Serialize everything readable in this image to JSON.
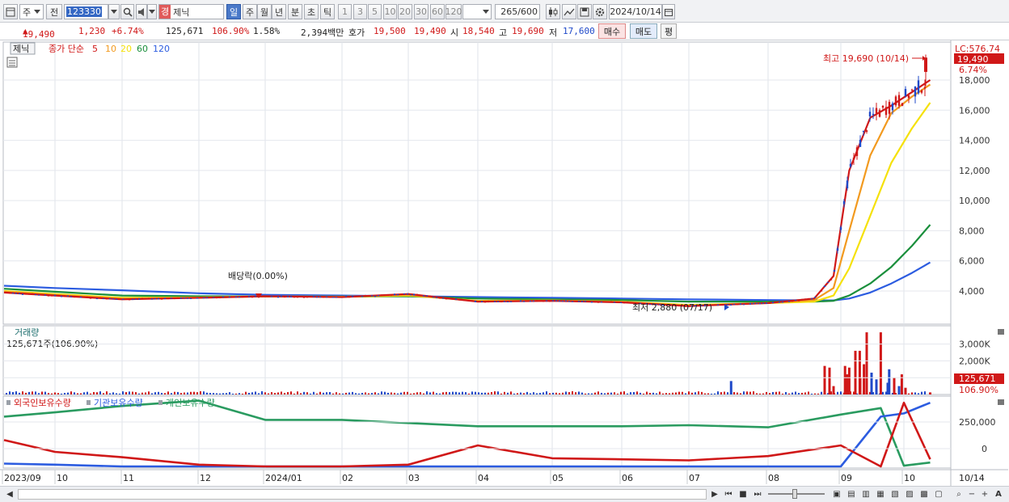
{
  "toolbar": {
    "market_label": "주",
    "prev_label": "전",
    "code_value": "123330",
    "grade_badge": "경",
    "stock_name": "제닉",
    "period_tabs": [
      "일",
      "주",
      "월",
      "년",
      "분",
      "초",
      "틱"
    ],
    "interval_buttons": [
      "1",
      "3",
      "5",
      "10",
      "20",
      "30",
      "60",
      "120"
    ],
    "count_value": "265",
    "count_total": "/600",
    "date_value": "2024/10/14"
  },
  "info": {
    "price": "19,490",
    "change": "1,230",
    "change_pct": "+6.74%",
    "volume": "125,671",
    "volume_ratio": "106.90%",
    "turnover": "1.58%",
    "amount": "2,394백만",
    "quote_label": "호가",
    "ask": "19,500",
    "bid": "19,490",
    "open_label": "시",
    "open": "18,540",
    "high_label": "고",
    "high": "19,690",
    "low_label": "저",
    "low": "17,600",
    "buy_label": "매수",
    "sell_label": "매도",
    "avg_label": "평"
  },
  "colors": {
    "up": "#d01818",
    "down": "#1f49c9",
    "ma5": "#d01818",
    "ma10": "#f29a1f",
    "ma20": "#f5e10a",
    "ma60": "#1a8f3c",
    "ma120": "#2c5ce0",
    "foreign": "#d01818",
    "institution": "#2c5ce0",
    "individual": "#2a9b60"
  },
  "price_panel": {
    "stock_label": "제닉",
    "legend_prefix": "종가 단순",
    "ma_periods": [
      "5",
      "10",
      "20",
      "60",
      "120"
    ],
    "lc_label": "LC:576.74",
    "price_badge": "19,490",
    "pct_label": "6.74%",
    "high_annotation": "최고 19,690 (10/14)",
    "low_annotation": "최저 2,880 (07/17)",
    "dividend_annotation": "배당락(0.00%)",
    "y_ticks": [
      "18,000",
      "16,000",
      "14,000",
      "12,000",
      "10,000",
      "8,000",
      "6,000",
      "4,000"
    ]
  },
  "volume_panel": {
    "title": "거래량",
    "value_label": "125,671주(106.90%)",
    "y_ticks": [
      "3,000K",
      "2,000K",
      "1,000K"
    ],
    "badge_value": "125,671",
    "badge_pct": "106.90%"
  },
  "holding_panel": {
    "legend": [
      "외국인보유수량",
      "기관보유수량",
      "개인보유수량"
    ],
    "y_ticks": [
      "250,000",
      "0"
    ]
  },
  "x_axis": {
    "labels": [
      "2023/09",
      "10",
      "11",
      "12",
      "2024/01",
      "02",
      "03",
      "04",
      "05",
      "06",
      "07",
      "08",
      "09",
      "10",
      "10/14"
    ]
  },
  "chart_data": {
    "type": "line",
    "title": "",
    "xlabel": "",
    "ylabel": "",
    "x_range": [
      "2023/09",
      "2024/10/14"
    ],
    "ylim": [
      2000,
      20000
    ],
    "ohlc_last": {
      "open": 18540,
      "high": 19690,
      "low": 17600,
      "close": 19490
    },
    "annotations": [
      {
        "text": "최고 19,690 (10/14)",
        "x": "2024/10/14",
        "y": 19690
      },
      {
        "text": "최저 2,880 (07/17)",
        "x": "2024/07/17",
        "y": 2880
      },
      {
        "text": "배당락(0.00%)",
        "x": "2023/12"
      }
    ],
    "series": [
      {
        "name": "5",
        "x": [
          "2023/09",
          "2023/10",
          "2023/11",
          "2023/12",
          "2024/01",
          "2024/02",
          "2024/03",
          "2024/04",
          "2024/05",
          "2024/06",
          "2024/07",
          "2024/08",
          "2024/08/20",
          "2024/08/28",
          "2024/09/05",
          "2024/09/15",
          "2024/09/25",
          "2024/10/05",
          "2024/10/14"
        ],
        "values": [
          3900,
          3700,
          3450,
          3550,
          3650,
          3600,
          3800,
          3300,
          3350,
          3250,
          3000,
          3200,
          3500,
          5000,
          12000,
          15500,
          16300,
          17200,
          18000
        ]
      },
      {
        "name": "10",
        "x": [
          "2023/09",
          "2023/10",
          "2023/11",
          "2023/12",
          "2024/01",
          "2024/02",
          "2024/03",
          "2024/04",
          "2024/05",
          "2024/06",
          "2024/07",
          "2024/08",
          "2024/08/20",
          "2024/08/28",
          "2024/09/05",
          "2024/09/15",
          "2024/09/25",
          "2024/10/05",
          "2024/10/14"
        ],
        "values": [
          3950,
          3750,
          3500,
          3560,
          3650,
          3610,
          3750,
          3320,
          3360,
          3270,
          3030,
          3200,
          3400,
          4200,
          8000,
          13000,
          15800,
          16900,
          17700
        ]
      },
      {
        "name": "20",
        "x": [
          "2023/09",
          "2023/10",
          "2023/11",
          "2023/12",
          "2024/01",
          "2024/02",
          "2024/03",
          "2024/04",
          "2024/05",
          "2024/06",
          "2024/07",
          "2024/08",
          "2024/08/20",
          "2024/08/28",
          "2024/09/05",
          "2024/09/15",
          "2024/09/25",
          "2024/10/05",
          "2024/10/14"
        ],
        "values": [
          4000,
          3800,
          3550,
          3570,
          3640,
          3620,
          3700,
          3350,
          3370,
          3290,
          3080,
          3200,
          3300,
          3700,
          5500,
          9000,
          12500,
          14800,
          16500
        ]
      },
      {
        "name": "60",
        "x": [
          "2023/09",
          "2023/10",
          "2023/11",
          "2023/12",
          "2024/01",
          "2024/02",
          "2024/03",
          "2024/04",
          "2024/05",
          "2024/06",
          "2024/07",
          "2024/08",
          "2024/08/20",
          "2024/08/28",
          "2024/09/05",
          "2024/09/15",
          "2024/09/25",
          "2024/10/05",
          "2024/10/14"
        ],
        "values": [
          4150,
          3950,
          3700,
          3650,
          3640,
          3630,
          3650,
          3500,
          3450,
          3400,
          3300,
          3300,
          3300,
          3350,
          3700,
          4500,
          5600,
          7000,
          8400
        ]
      },
      {
        "name": "120",
        "x": [
          "2023/09",
          "2023/10",
          "2023/11",
          "2023/12",
          "2024/01",
          "2024/02",
          "2024/03",
          "2024/04",
          "2024/05",
          "2024/06",
          "2024/07",
          "2024/08",
          "2024/08/20",
          "2024/08/28",
          "2024/09/05",
          "2024/09/15",
          "2024/09/25",
          "2024/10/05",
          "2024/10/14"
        ],
        "values": [
          4350,
          4200,
          4050,
          3850,
          3750,
          3700,
          3650,
          3600,
          3550,
          3500,
          3450,
          3400,
          3380,
          3380,
          3500,
          3900,
          4500,
          5200,
          5900
        ]
      }
    ],
    "volume_series": {
      "name": "거래량",
      "x": [
        "2024/07/17",
        "2024/08/28",
        "2024/09/03",
        "2024/09/05",
        "2024/09/10",
        "2024/09/12",
        "2024/09/20",
        "2024/09/24",
        "2024/09/30",
        "2024/10/14"
      ],
      "values": [
        800000,
        500000,
        1700000,
        1600000,
        2600000,
        1800000,
        3700000,
        1500000,
        1200000,
        125671
      ],
      "ylim": [
        0,
        3800000
      ]
    },
    "holding_series": [
      {
        "name": "외국인보유수량",
        "x": [
          "2023/09",
          "2023/10",
          "2023/11",
          "2023/12",
          "2024/01",
          "2024/02",
          "2024/03",
          "2024/04",
          "2024/05",
          "2024/06",
          "2024/07",
          "2024/08",
          "2024/09",
          "2024/09/20",
          "2024/10/01",
          "2024/10/14"
        ],
        "values": [
          80000,
          -30000,
          -80000,
          -150000,
          -190000,
          -170000,
          -150000,
          30000,
          -90000,
          -100000,
          -110000,
          -70000,
          30000,
          -230000,
          430000,
          -100000
        ]
      },
      {
        "name": "기관보유수량",
        "x": [
          "2023/09",
          "2023/10",
          "2023/11",
          "2023/12",
          "2024/01",
          "2024/02",
          "2024/03",
          "2024/04",
          "2024/05",
          "2024/06",
          "2024/07",
          "2024/08",
          "2024/09",
          "2024/09/20",
          "2024/10/01",
          "2024/10/14"
        ],
        "values": [
          -140000,
          -150000,
          -200000,
          -200000,
          -200000,
          -200000,
          -200000,
          -200000,
          -200000,
          -200000,
          -200000,
          -200000,
          -180000,
          300000,
          330000,
          430000
        ]
      },
      {
        "name": "개인보유수량",
        "x": [
          "2023/09",
          "2023/10",
          "2023/11",
          "2023/12",
          "2024/01",
          "2024/02",
          "2024/03",
          "2024/04",
          "2024/05",
          "2024/06",
          "2024/07",
          "2024/08",
          "2024/09",
          "2024/09/20",
          "2024/10/01",
          "2024/10/14"
        ],
        "values": [
          300000,
          340000,
          400000,
          450000,
          270000,
          270000,
          240000,
          210000,
          210000,
          210000,
          220000,
          200000,
          320000,
          380000,
          -160000,
          -130000
        ]
      }
    ]
  }
}
